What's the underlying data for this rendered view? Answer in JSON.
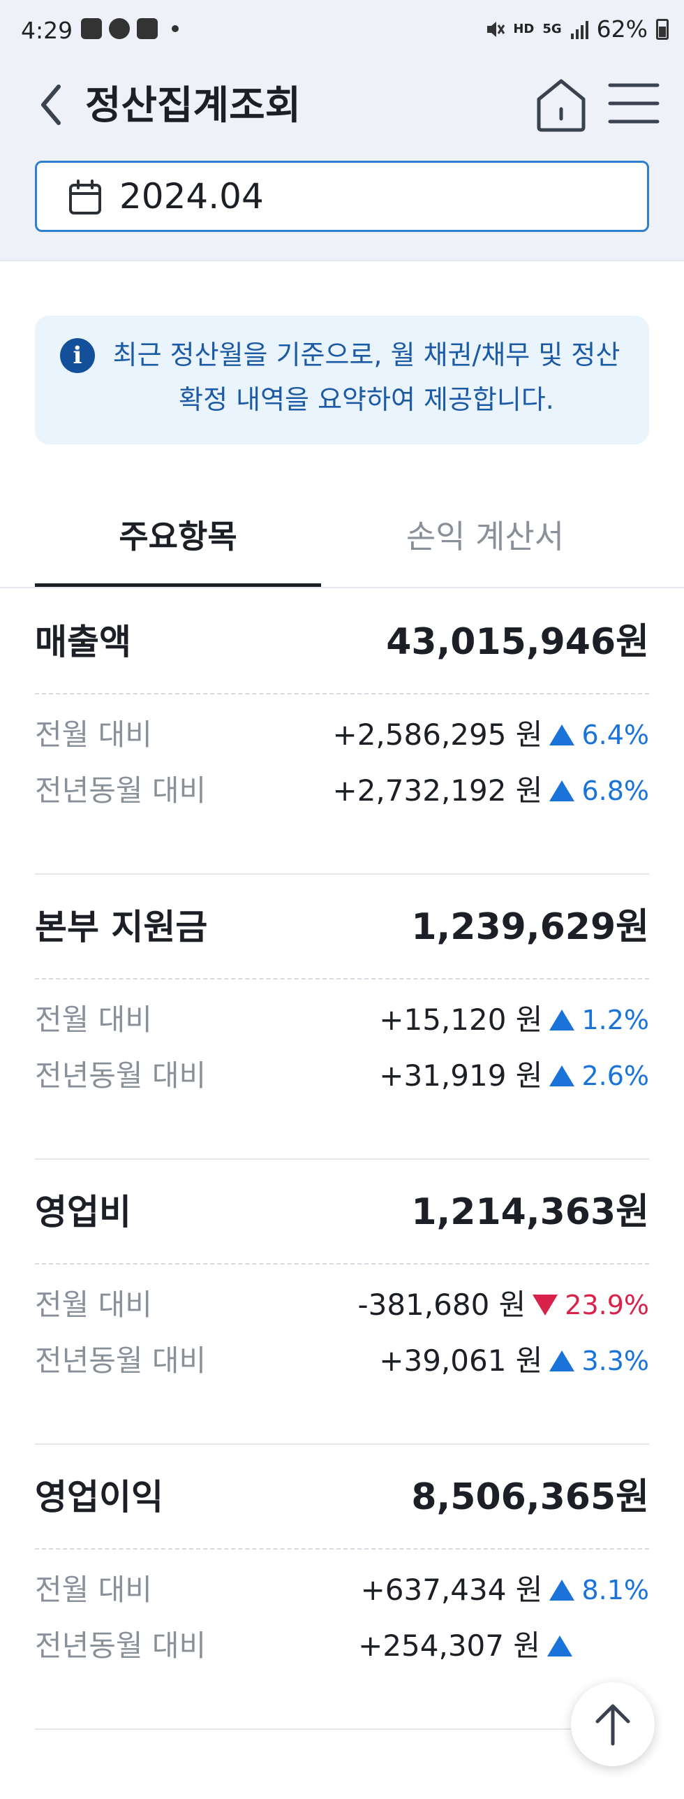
{
  "status_bar": {
    "time": "4:29",
    "battery": "62%",
    "network": "5G",
    "hd_label": "HD"
  },
  "header": {
    "title": "정산집계조회",
    "date": "2024.04"
  },
  "notice": {
    "text": "최근 정산월을 기준으로, 월 채권/채무 및 정산 확정 내역을 요약하여 제공합니다."
  },
  "tabs": [
    {
      "label": "주요항목"
    },
    {
      "label": "손익 계산서"
    }
  ],
  "metrics": [
    {
      "name": "매출액",
      "total": "43,015,946원",
      "rows": [
        {
          "label": "전월 대비",
          "amount": "+2,586,295 원",
          "percent": "6.4%",
          "direction": "up"
        },
        {
          "label": "전년동월 대비",
          "amount": "+2,732,192 원",
          "percent": "6.8%",
          "direction": "up"
        }
      ]
    },
    {
      "name": "본부 지원금",
      "total": "1,239,629원",
      "rows": [
        {
          "label": "전월 대비",
          "amount": "+15,120 원",
          "percent": "1.2%",
          "direction": "up"
        },
        {
          "label": "전년동월 대비",
          "amount": "+31,919 원",
          "percent": "2.6%",
          "direction": "up"
        }
      ]
    },
    {
      "name": "영업비",
      "total": "1,214,363원",
      "rows": [
        {
          "label": "전월 대비",
          "amount": "-381,680 원",
          "percent": "23.9%",
          "direction": "down"
        },
        {
          "label": "전년동월 대비",
          "amount": "+39,061 원",
          "percent": "3.3%",
          "direction": "up"
        }
      ]
    },
    {
      "name": "영업이익",
      "total": "8,506,365원",
      "rows": [
        {
          "label": "전월 대비",
          "amount": "+637,434 원",
          "percent": "8.1%",
          "direction": "up"
        },
        {
          "label": "전년동월 대비",
          "amount": "+254,307 원",
          "percent": "",
          "direction": "up"
        }
      ]
    }
  ],
  "colors": {
    "accent": "#2f7fd1",
    "up": "#1a73d9",
    "down": "#d9224a",
    "header_bg": "#eef2f8",
    "notice_bg": "#eaf4fd"
  },
  "icons": [
    "back-arrow-icon",
    "home-icon",
    "hamburger-menu-icon",
    "calendar-icon",
    "info-icon",
    "arrow-up-icon"
  ]
}
